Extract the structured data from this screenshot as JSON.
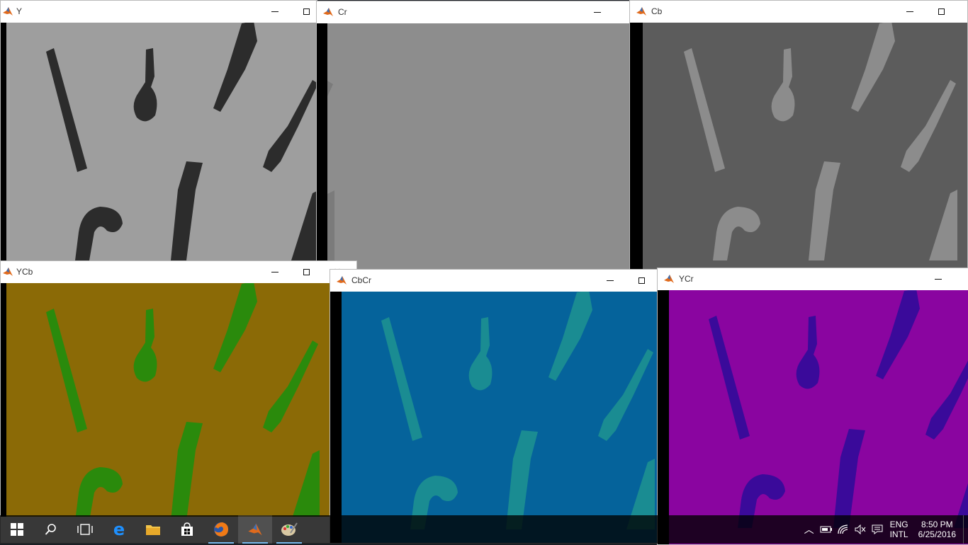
{
  "windows": [
    {
      "id": "y",
      "title": "Y"
    },
    {
      "id": "cr",
      "title": "Cr"
    },
    {
      "id": "cb",
      "title": "Cb"
    },
    {
      "id": "ycb",
      "title": "YCb"
    },
    {
      "id": "cbcr",
      "title": "CbCr"
    },
    {
      "id": "ycr",
      "title": "YCr"
    }
  ],
  "colors": {
    "y_bg": "#9e9e9e",
    "y_obj": "#2c2c2c",
    "cr_bg": "#8d8d8d",
    "cr_obj": "#7b7b7b",
    "cb_bg": "#5c5c5c",
    "cb_obj": "#8c8c8c",
    "ycb_bg": "#8b6a06",
    "ycb_obj": "#2a8a0c",
    "cbcr_bg": "#05639b",
    "cbcr_obj": "#1a8c92",
    "ycr_bg": "#8a05a0",
    "ycr_obj": "#3a0a9a"
  },
  "taskbar": {
    "items": [
      "windows-start",
      "search",
      "task-view",
      "edge",
      "file-explorer",
      "store",
      "firefox",
      "matlab",
      "paint"
    ],
    "tray": {
      "lang_line1": "ENG",
      "lang_line2": "INTL",
      "time": "8:50 PM",
      "date": "6/25/2016"
    }
  }
}
